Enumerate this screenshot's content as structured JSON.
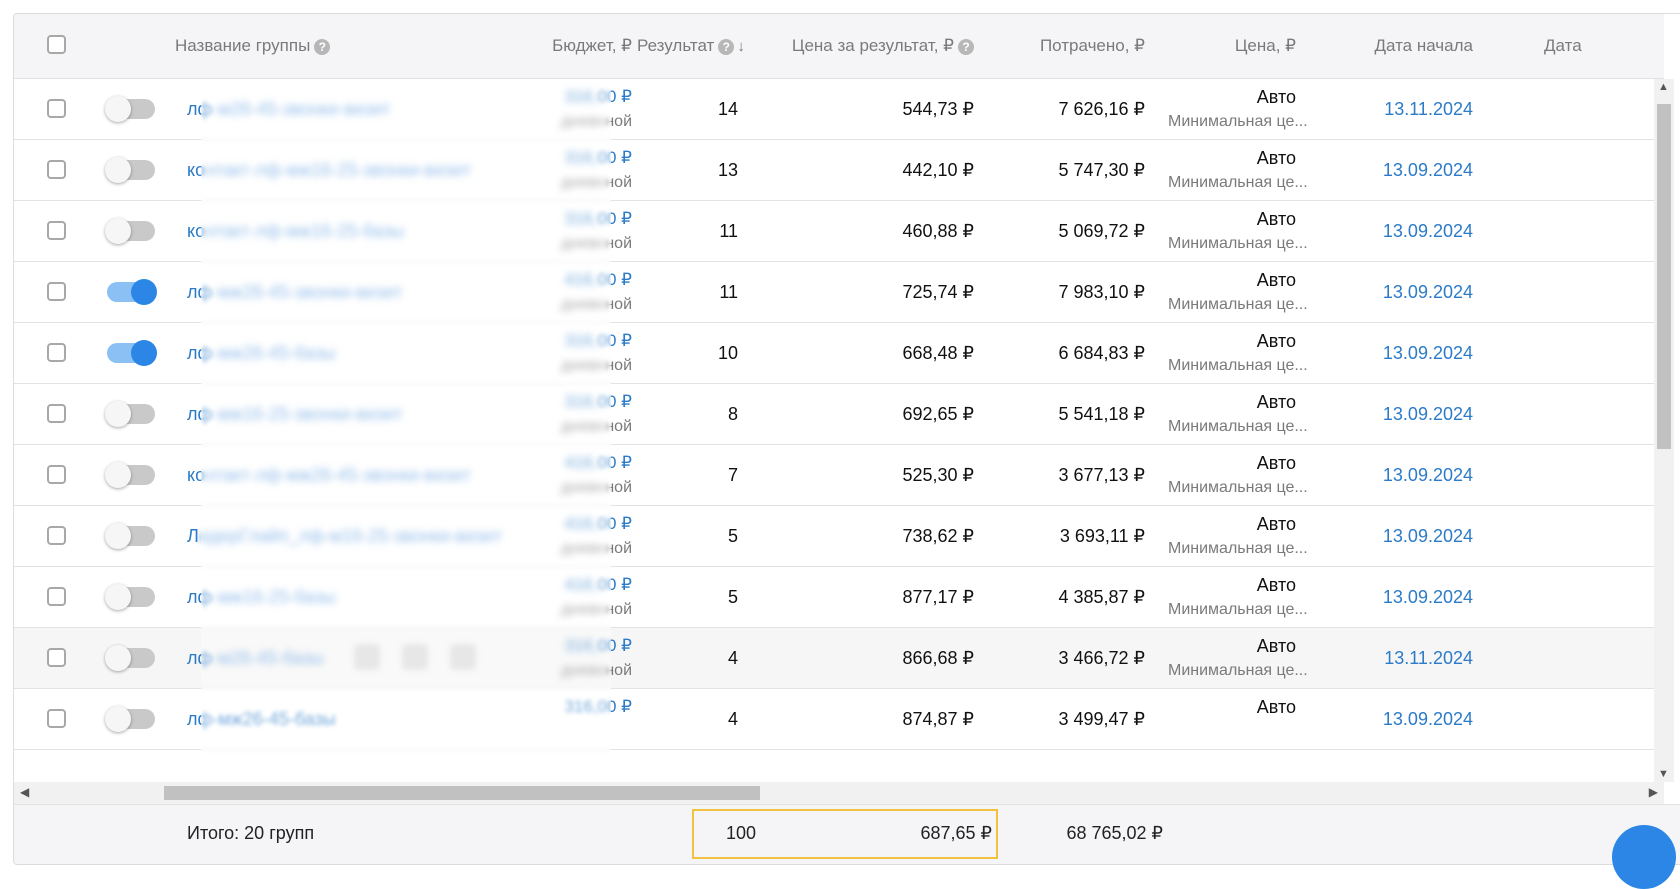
{
  "header": {
    "name": "Название группы",
    "budget": "Бюджет, ₽",
    "result": "Результат",
    "cpr": "Цена за результат, ₽",
    "spent": "Потрачено, ₽",
    "price": "Цена, ₽",
    "start": "Дата начала",
    "end": "Дата"
  },
  "rows": [
    {
      "name_prefix": "лф",
      "name_blur": "-м26-45-звонки-визит",
      "budget_blur": "316,",
      "budget_tail": "00 ₽",
      "budget_sub_blur": "дневн",
      "budget_sub_tail": "ной",
      "result": "14",
      "cpr": "544,73 ₽",
      "spent": "7 626,16 ₽",
      "price": "Авто",
      "price_sub": "Минимальная це...",
      "start": "13.11.2024",
      "active": false
    },
    {
      "name_prefix": "ко",
      "name_blur": "нтакт-лф-мж16-25-звонки-визит",
      "budget_blur": "316,",
      "budget_tail": "00 ₽",
      "budget_sub_blur": "дневн",
      "budget_sub_tail": "ной",
      "result": "13",
      "cpr": "442,10 ₽",
      "spent": "5 747,30 ₽",
      "price": "Авто",
      "price_sub": "Минимальная це...",
      "start": "13.09.2024",
      "active": false
    },
    {
      "name_prefix": "ко",
      "name_blur": "нтакт-лф-мж16-25-базы",
      "budget_blur": "316,",
      "budget_tail": "00 ₽",
      "budget_sub_blur": "дневн",
      "budget_sub_tail": "ной",
      "result": "11",
      "cpr": "460,88 ₽",
      "spent": "5 069,72 ₽",
      "price": "Авто",
      "price_sub": "Минимальная це...",
      "start": "13.09.2024",
      "active": false
    },
    {
      "name_prefix": "лф",
      "name_blur": "-мж26-45-звонки-визит",
      "budget_blur": "416,",
      "budget_tail": "00 ₽",
      "budget_sub_blur": "дневн",
      "budget_sub_tail": "ной",
      "result": "11",
      "cpr": "725,74 ₽",
      "spent": "7 983,10 ₽",
      "price": "Авто",
      "price_sub": "Минимальная це...",
      "start": "13.09.2024",
      "active": true
    },
    {
      "name_prefix": "лф",
      "name_blur": "-мж26-45-базы",
      "budget_blur": "316,",
      "budget_tail": "00 ₽",
      "budget_sub_blur": "дневн",
      "budget_sub_tail": "ной",
      "result": "10",
      "cpr": "668,48 ₽",
      "spent": "6 684,83 ₽",
      "price": "Авто",
      "price_sub": "Минимальная це...",
      "start": "13.09.2024",
      "active": true
    },
    {
      "name_prefix": "лф",
      "name_blur": "-мж16-25-звонки-визит",
      "budget_blur": "316,",
      "budget_tail": "00 ₽",
      "budget_sub_blur": "дневн",
      "budget_sub_tail": "ной",
      "result": "8",
      "cpr": "692,65 ₽",
      "spent": "5 541,18 ₽",
      "price": "Авто",
      "price_sub": "Минимальная це...",
      "start": "13.09.2024",
      "active": false
    },
    {
      "name_prefix": "ко",
      "name_blur": "нтакт-лф-мж26-45-звонки-визит",
      "budget_blur": "416,",
      "budget_tail": "00 ₽",
      "budget_sub_blur": "дневн",
      "budget_sub_tail": "ной",
      "result": "7",
      "cpr": "525,30 ₽",
      "spent": "3 677,13 ₽",
      "price": "Авто",
      "price_sub": "Минимальная це...",
      "start": "13.09.2024",
      "active": false
    },
    {
      "name_prefix": "Л",
      "name_blur": "идерГлайп_лф-м16-25-звонки-визит",
      "budget_blur": "416,",
      "budget_tail": "00 ₽",
      "budget_sub_blur": "дневн",
      "budget_sub_tail": "ной",
      "result": "5",
      "cpr": "738,62 ₽",
      "spent": "3 693,11 ₽",
      "price": "Авто",
      "price_sub": "Минимальная це...",
      "start": "13.09.2024",
      "active": false
    },
    {
      "name_prefix": "лф",
      "name_blur": "-мж16-25-базы",
      "budget_blur": "416,",
      "budget_tail": "00 ₽",
      "budget_sub_blur": "дневн",
      "budget_sub_tail": "ной",
      "result": "5",
      "cpr": "877,17 ₽",
      "spent": "4 385,87 ₽",
      "price": "Авто",
      "price_sub": "Минимальная це...",
      "start": "13.09.2024",
      "active": false
    },
    {
      "name_prefix": "лф",
      "name_blur": "-м26-45-базы",
      "budget_blur": "316,",
      "budget_tail": "00 ₽",
      "budget_sub_blur": "дневн",
      "budget_sub_tail": "ной",
      "result": "4",
      "cpr": "866,68 ₽",
      "spent": "3 466,72 ₽",
      "price": "Авто",
      "price_sub": "Минимальная це...",
      "start": "13.11.2024",
      "active": false,
      "hover": true
    },
    {
      "name_prefix": "лф-мж26-45-базы",
      "name_blur": "",
      "budget_blur": "",
      "budget_tail": "316,00 ₽",
      "budget_sub_blur": "",
      "budget_sub_tail": "",
      "result": "4",
      "cpr": "874,87 ₽",
      "spent": "3 499,47 ₽",
      "price": "Авто",
      "price_sub": "",
      "start": "13.09.2024",
      "active": false
    }
  ],
  "footer": {
    "total_label": "Итого: 20 групп",
    "result": "100",
    "cpr": "687,65 ₽",
    "spent": "68 765,02 ₽"
  },
  "colors": {
    "accent": "#2b86e6",
    "link": "#2b7bc8",
    "highlight": "#f0c23d"
  }
}
